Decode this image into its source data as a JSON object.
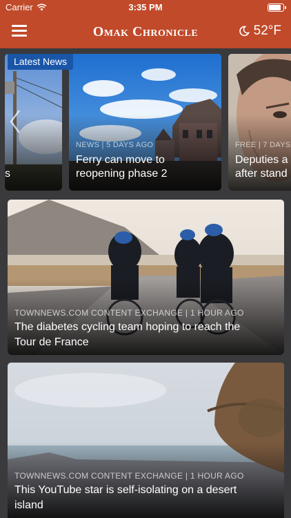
{
  "status_bar": {
    "carrier": "Carrier",
    "time": "3:35 PM"
  },
  "header": {
    "title": "Omak Chronicle",
    "weather": "52°F"
  },
  "section_label": "Latest News",
  "carousel": [
    {
      "meta": "",
      "title": "s",
      "image": "power-pole-photo"
    },
    {
      "meta": "NEWS | 5 DAYS AGO",
      "title": "Ferry can move to reopening phase 2",
      "image": "waterfront-houses-photo"
    },
    {
      "meta": "FREE | 7 DAYS",
      "title": "Deputies a after stand",
      "image": "man-portrait-photo"
    }
  ],
  "stories": [
    {
      "meta": "TOWNNEWS.COM CONTENT EXCHANGE | 1 HOUR AGO",
      "title": "The diabetes cycling team hoping to reach the Tour de France",
      "image": "cyclists-photo"
    },
    {
      "meta": "TOWNNEWS.COM CONTENT EXCHANGE | 1 HOUR AGO",
      "title": "This YouTube star is self-isolating on a desert island",
      "image": "desert-island-photo"
    }
  ],
  "colors": {
    "brand": "#c04a2a",
    "label": "#1a56a8",
    "background": "#3a3a3c"
  }
}
